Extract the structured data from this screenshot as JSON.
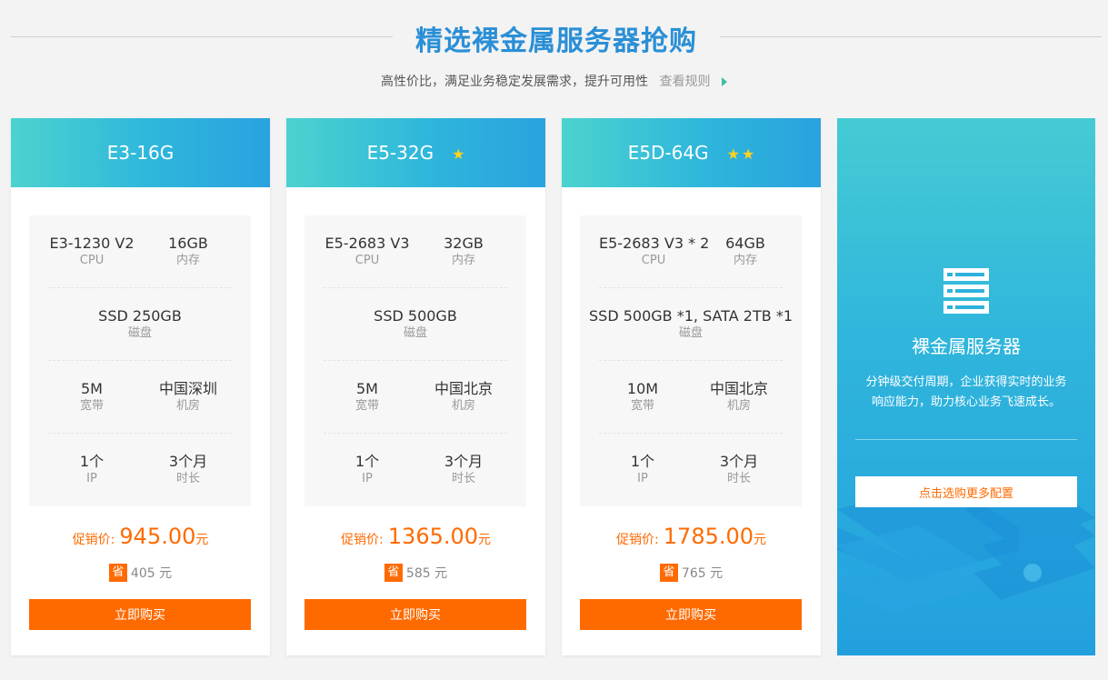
{
  "header": {
    "title": "精选裸金属服务器抢购",
    "subtitle": "高性价比，满足业务稳定发展需求，提升可用性",
    "rules_link": "查看规则"
  },
  "colors": {
    "accent_blue": "#2a8fd6",
    "accent_orange": "#ff6a00",
    "star_yellow": "#ffd21f"
  },
  "cards": [
    {
      "name": "E3-16G",
      "stars": 0,
      "cpu": "E3-1230 V2",
      "cpu_label": "CPU",
      "mem": "16GB",
      "mem_label": "内存",
      "disk": "SSD 250GB",
      "disk_label": "磁盘",
      "bw": "5M",
      "bw_label": "宽带",
      "room": "中国深圳",
      "room_label": "机房",
      "ip": "1个",
      "ip_label": "IP",
      "dur": "3个月",
      "dur_label": "时长",
      "price_label": "促销价:",
      "price": "945.00",
      "price_unit": "元",
      "save_badge": "省",
      "save": "405 元",
      "buy": "立即购买"
    },
    {
      "name": "E5-32G",
      "stars": 1,
      "cpu": "E5-2683 V3",
      "cpu_label": "CPU",
      "mem": "32GB",
      "mem_label": "内存",
      "disk": "SSD 500GB",
      "disk_label": "磁盘",
      "bw": "5M",
      "bw_label": "宽带",
      "room": "中国北京",
      "room_label": "机房",
      "ip": "1个",
      "ip_label": "IP",
      "dur": "3个月",
      "dur_label": "时长",
      "price_label": "促销价:",
      "price": "1365.00",
      "price_unit": "元",
      "save_badge": "省",
      "save": "585 元",
      "buy": "立即购买"
    },
    {
      "name": "E5D-64G",
      "stars": 2,
      "cpu": "E5-2683 V3 * 2",
      "cpu_label": "CPU",
      "mem": "64GB",
      "mem_label": "内存",
      "disk": "SSD 500GB *1, SATA 2TB *1",
      "disk_label": "磁盘",
      "bw": "10M",
      "bw_label": "宽带",
      "room": "中国北京",
      "room_label": "机房",
      "ip": "1个",
      "ip_label": "IP",
      "dur": "3个月",
      "dur_label": "时长",
      "price_label": "促销价:",
      "price": "1785.00",
      "price_unit": "元",
      "save_badge": "省",
      "save": "765 元",
      "buy": "立即购买"
    }
  ],
  "promo": {
    "icon": "server-rack-icon",
    "title": "裸金属服务器",
    "desc_line1": "分钟级交付周期，企业获得实时的业务",
    "desc_line2": "响应能力，助力核心业务飞速成长。",
    "button": "点击选购更多配置"
  }
}
